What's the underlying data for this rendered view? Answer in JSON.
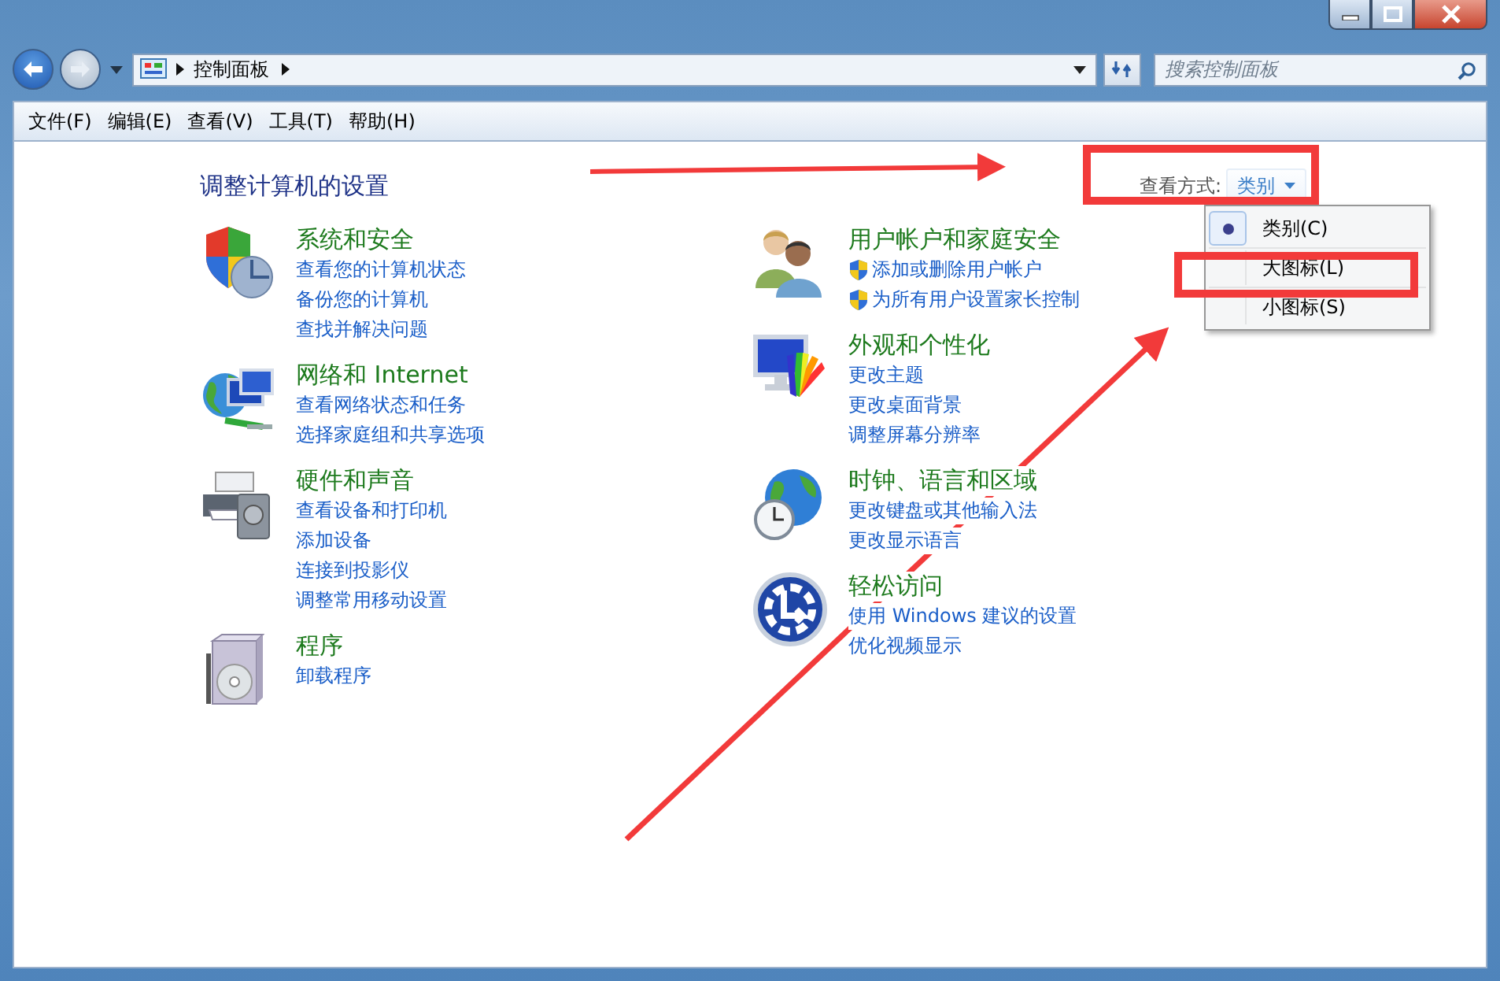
{
  "address_bar": {
    "crumbs": [
      "控制面板"
    ]
  },
  "search": {
    "placeholder": "搜索控制面板"
  },
  "menu_bar": [
    "文件(F)",
    "编辑(E)",
    "查看(V)",
    "工具(T)",
    "帮助(H)"
  ],
  "heading": "调整计算机的设置",
  "view_by": {
    "label": "查看方式:",
    "value": "类别"
  },
  "view_menu": [
    {
      "label": "类别(C)",
      "selected": true
    },
    {
      "label": "大图标(L)",
      "selected": false
    },
    {
      "label": "小图标(S)",
      "selected": false
    }
  ],
  "left_column": [
    {
      "kind": "security",
      "title": "系统和安全",
      "links": [
        {
          "text": "查看您的计算机状态",
          "shield": false
        },
        {
          "text": "备份您的计算机",
          "shield": false
        },
        {
          "text": "查找并解决问题",
          "shield": false
        }
      ]
    },
    {
      "kind": "network",
      "title": "网络和 Internet",
      "links": [
        {
          "text": "查看网络状态和任务",
          "shield": false
        },
        {
          "text": "选择家庭组和共享选项",
          "shield": false
        }
      ]
    },
    {
      "kind": "hardware",
      "title": "硬件和声音",
      "links": [
        {
          "text": "查看设备和打印机",
          "shield": false
        },
        {
          "text": "添加设备",
          "shield": false
        },
        {
          "text": "连接到投影仪",
          "shield": false
        },
        {
          "text": "调整常用移动设置",
          "shield": false
        }
      ]
    },
    {
      "kind": "programs",
      "title": "程序",
      "links": [
        {
          "text": "卸载程序",
          "shield": false
        }
      ]
    }
  ],
  "right_column": [
    {
      "kind": "users",
      "title": "用户帐户和家庭安全",
      "links": [
        {
          "text": "添加或删除用户帐户",
          "shield": true
        },
        {
          "text": "为所有用户设置家长控制",
          "shield": true
        }
      ]
    },
    {
      "kind": "appearance",
      "title": "外观和个性化",
      "links": [
        {
          "text": "更改主题",
          "shield": false
        },
        {
          "text": "更改桌面背景",
          "shield": false
        },
        {
          "text": "调整屏幕分辨率",
          "shield": false
        }
      ]
    },
    {
      "kind": "clock",
      "title": "时钟、语言和区域",
      "links": [
        {
          "text": "更改键盘或其他输入法",
          "shield": false
        },
        {
          "text": "更改显示语言",
          "shield": false
        }
      ]
    },
    {
      "kind": "access",
      "title": "轻松访问",
      "links": [
        {
          "text": "使用 Windows 建议的设置",
          "shield": false
        },
        {
          "text": "优化视频显示",
          "shield": false
        }
      ]
    }
  ]
}
